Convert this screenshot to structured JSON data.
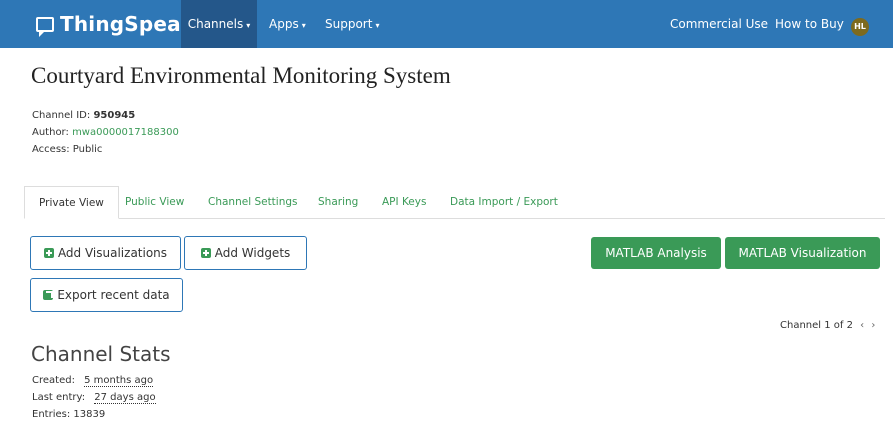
{
  "navbar": {
    "brand": "ThingSpeak",
    "trademark": "™",
    "items": [
      "Channels",
      "Apps",
      "Support"
    ],
    "right_items": [
      "Commercial Use",
      "How to Buy"
    ],
    "avatar_initials": "HL",
    "colors": {
      "bar": "#2e77b6",
      "active": "#24578a",
      "avatar": "#7d6a1e"
    }
  },
  "channel": {
    "title": "Courtyard Environmental Monitoring System",
    "id_label": "Channel ID:",
    "id_value": "950945",
    "author_label": "Author:",
    "author_value": "mwa0000017188300",
    "access_label": "Access:",
    "access_value": "Public"
  },
  "tabs": [
    "Private View",
    "Public View",
    "Channel Settings",
    "Sharing",
    "API Keys",
    "Data Import / Export"
  ],
  "active_tab": "Private View",
  "buttons": {
    "add_visualizations": "Add Visualizations",
    "add_widgets": "Add Widgets",
    "export_recent_data": "Export recent data",
    "matlab_analysis": "MATLAB Analysis",
    "matlab_visualization": "MATLAB Visualization"
  },
  "pager": {
    "text": "Channel 1 of 2",
    "prev": "‹",
    "next": "›"
  },
  "stats": {
    "title": "Channel Stats",
    "created_label": "Created:",
    "created_value": "5 months ago",
    "last_entry_label": "Last entry:",
    "last_entry_value": "27 days ago",
    "entries_label": "Entries:",
    "entries_value": "13839"
  },
  "accent_green": "#3a9a57"
}
